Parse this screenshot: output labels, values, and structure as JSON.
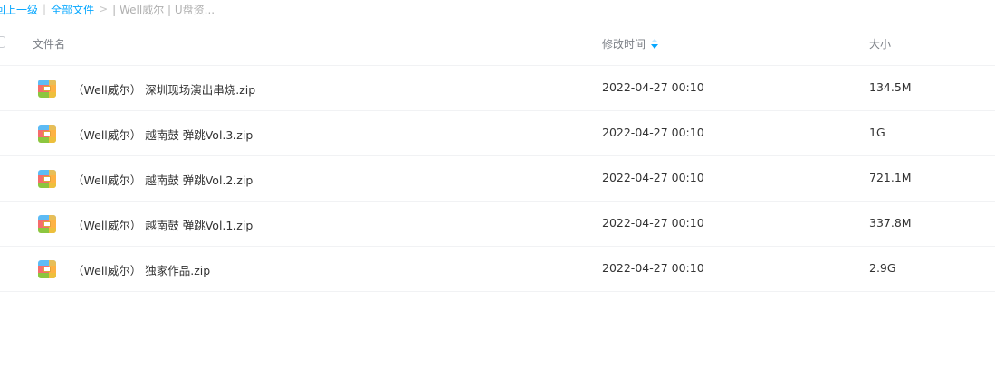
{
  "breadcrumb": {
    "back_label": "回上一级",
    "sep1": "|",
    "all_files_label": "全部文件",
    "sep2": ">",
    "current_label": "| Well威尔 | U盘资..."
  },
  "table": {
    "header": {
      "name": "文件名",
      "modified": "修改时间",
      "size": "大小"
    },
    "rows": [
      {
        "name": "（Well威尔） 深圳现场演出串烧.zip",
        "modified": "2022-04-27 00:10",
        "size": "134.5M",
        "icon": "zip-icon"
      },
      {
        "name": "（Well威尔） 越南鼓 弹跳Vol.3.zip",
        "modified": "2022-04-27 00:10",
        "size": "1G",
        "icon": "zip-icon"
      },
      {
        "name": "（Well威尔） 越南鼓 弹跳Vol.2.zip",
        "modified": "2022-04-27 00:10",
        "size": "721.1M",
        "icon": "zip-icon"
      },
      {
        "name": "（Well威尔） 越南鼓 弹跳Vol.1.zip",
        "modified": "2022-04-27 00:10",
        "size": "337.8M",
        "icon": "zip-icon"
      },
      {
        "name": "（Well威尔） 独家作品.zip",
        "modified": "2022-04-27 00:10",
        "size": "2.9G",
        "icon": "zip-icon"
      }
    ]
  },
  "colors": {
    "link": "#06a7ff",
    "divider": "#f1f2f4",
    "header_text": "#7b7f86",
    "body_text": "#333333"
  }
}
